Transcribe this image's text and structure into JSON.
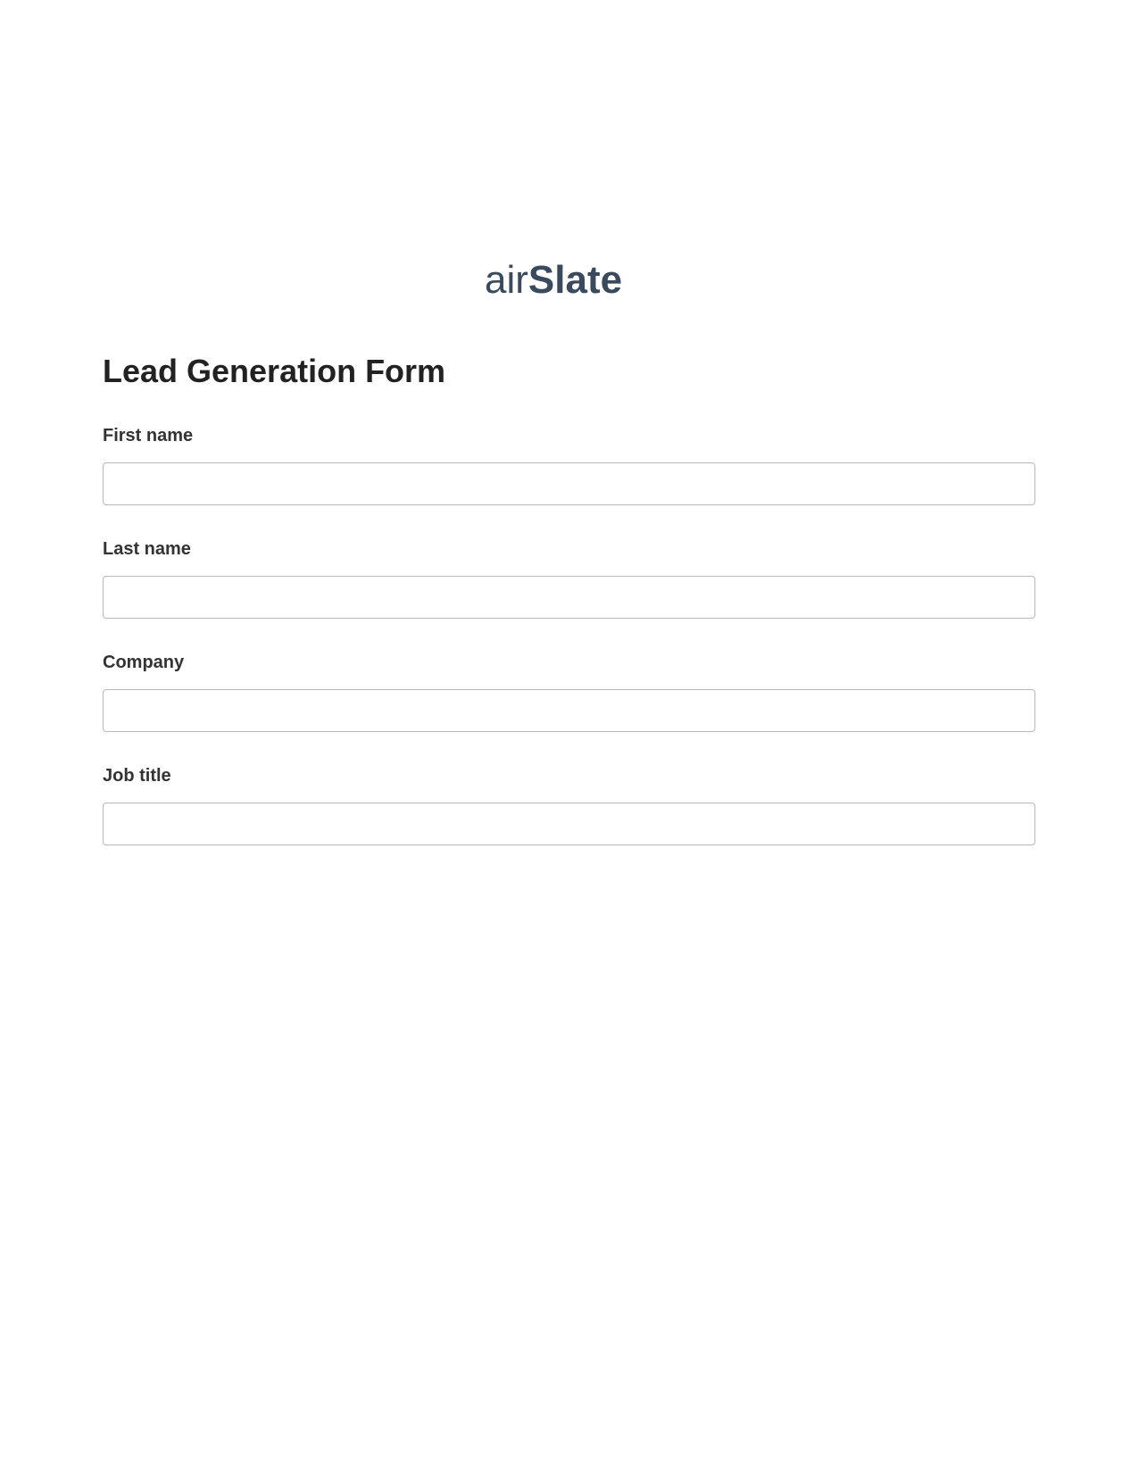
{
  "brand": {
    "name_part1": "air",
    "name_part2": "Slate",
    "color": "#3a4a5e"
  },
  "form": {
    "title": "Lead Generation Form",
    "fields": [
      {
        "label": "First name",
        "value": ""
      },
      {
        "label": "Last name",
        "value": ""
      },
      {
        "label": "Company",
        "value": ""
      },
      {
        "label": "Job title",
        "value": ""
      }
    ]
  }
}
